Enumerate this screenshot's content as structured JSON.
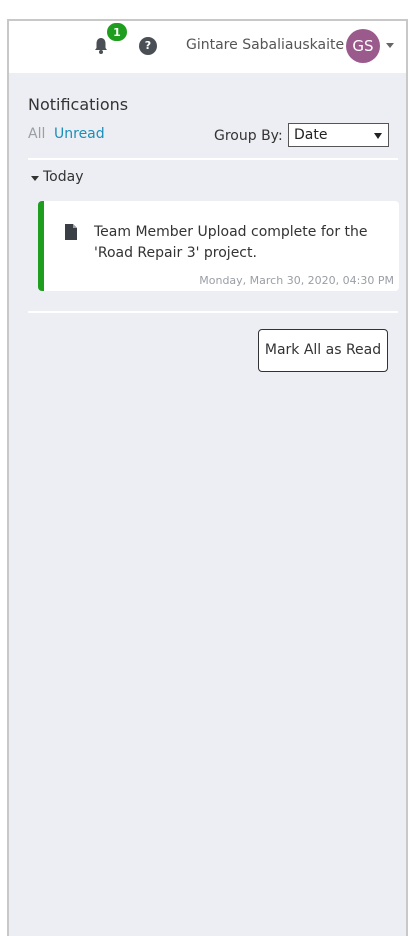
{
  "header": {
    "notification_count": "1",
    "help_label": "?",
    "user_name": "Gintare Sabaliauskaite",
    "avatar_initials": "GS"
  },
  "panel": {
    "title": "Notifications",
    "tabs": [
      {
        "label": "All",
        "active": false
      },
      {
        "label": "Unread",
        "active": true
      }
    ],
    "group_by_label": "Group By:",
    "group_by_value": "Date"
  },
  "groups": [
    {
      "label": "Today",
      "expanded": true,
      "items": [
        {
          "icon": "document-icon",
          "text": "Team Member Upload complete for the 'Road Repair 3' project.",
          "timestamp": "Monday, March 30, 2020, 04:30 PM",
          "unread": true
        }
      ]
    }
  ],
  "actions": {
    "mark_all_read_label": "Mark All as Read"
  },
  "colors": {
    "accent": "#1a8fb8",
    "unread_bar": "#1f9d1f",
    "badge": "#1f9d1f",
    "avatar": "#9b5a8c",
    "panel_bg": "#eceef3"
  }
}
